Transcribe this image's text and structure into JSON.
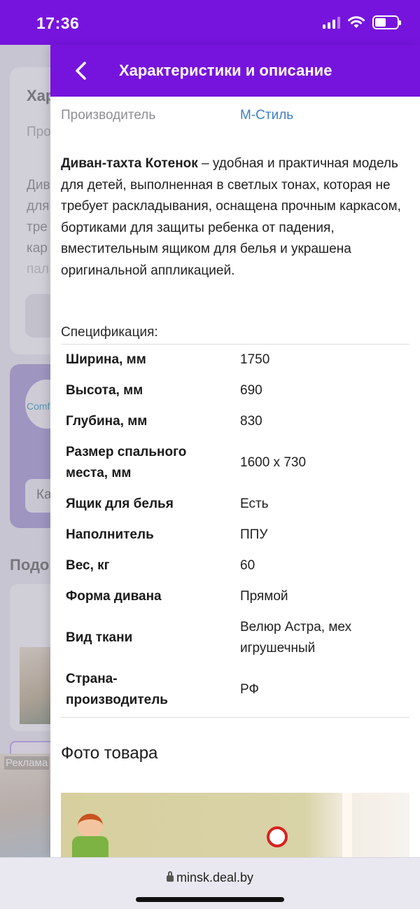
{
  "status_bar": {
    "time": "17:36"
  },
  "background": {
    "heading": "Хар",
    "sub": "Про",
    "lines": [
      "Див",
      "для",
      "тре",
      "кар",
      "пал"
    ],
    "promo_logo": "Comf",
    "promo_input": "Ка",
    "similar": "Подо",
    "ad_label": "Реклама"
  },
  "panel": {
    "title": "Характеристики и описание",
    "manufacturer_label": "Производитель",
    "manufacturer_value": "М-Стиль",
    "description_bold": "Диван-тахта Котенок",
    "description_rest": " – удобная и практичная модель для детей, выполненная в светлых тонах, которая не требует раскладывания, оснащена прочным каркасом, бортиками для защиты ребенка от падения, вместительным ящиком для белья и украшена оригинальной аппликацией.",
    "spec_label": "Спецификация:",
    "specs": [
      {
        "key": "Ширина, мм",
        "value": "1750"
      },
      {
        "key": "Высота, мм",
        "value": "690"
      },
      {
        "key": "Глубина, мм",
        "value": "830"
      },
      {
        "key": "Размер спального места, мм",
        "value": "1600 x 730"
      },
      {
        "key": "Ящик для белья",
        "value": "Есть"
      },
      {
        "key": "Наполнитель",
        "value": "ППУ"
      },
      {
        "key": "Вес, кг",
        "value": "60"
      },
      {
        "key": "Форма дивана",
        "value": "Прямой"
      },
      {
        "key": "Вид ткани",
        "value": "Велюр Астра, мех игрушечный"
      },
      {
        "key": "Страна-производитель",
        "value": "РФ"
      }
    ],
    "photo_title": "Фото товара"
  },
  "browser": {
    "url": "minsk.deal.by"
  },
  "colors": {
    "accent": "#7614dd",
    "link": "#3d7fc4"
  }
}
